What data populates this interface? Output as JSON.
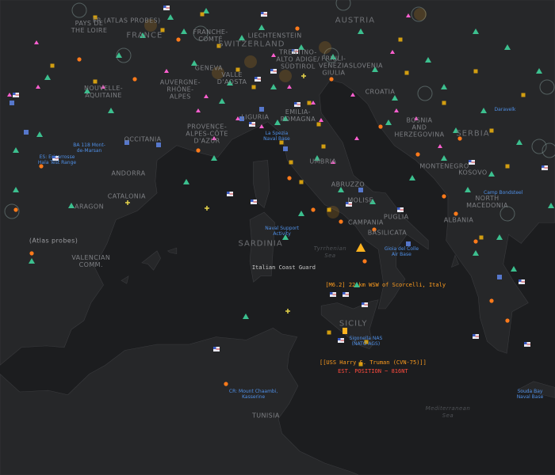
{
  "colors": {
    "land": "#262729",
    "sea": "#1c1d1f",
    "border": "#3a3b3e",
    "nuclear": "#3fd29a",
    "pink": "#ff5fd0",
    "orange": "#ff7a1a",
    "yellow": "#f1b40d",
    "base_label": "#4f8fe6",
    "alert": "#ff9d1f",
    "alert_red": "#ff4b3e"
  },
  "map_labels": [
    {
      "text": "FRANCE",
      "lon": 2.5,
      "lat": 47.2,
      "kind": "big"
    },
    {
      "text": "PAYS DE\nTHE LOIRE",
      "lon": -0.6,
      "lat": 47.5,
      "kind": "region"
    },
    {
      "text": "FR (Atlas probes)",
      "lon": 1.5,
      "lat": 47.7,
      "kind": "region"
    },
    {
      "text": "FRANCHE-\nCOMTÉ",
      "lon": 6.2,
      "lat": 47.2,
      "kind": "region"
    },
    {
      "text": "AUSTRIA",
      "lon": 14.3,
      "lat": 47.7,
      "kind": "big"
    },
    {
      "text": "LIECHTENSTEIN",
      "lon": 9.8,
      "lat": 47.2,
      "kind": "region"
    },
    {
      "text": "SWITZERLAND",
      "lon": 8.5,
      "lat": 46.9,
      "kind": "big"
    },
    {
      "text": "TRENTINO-\nALTO ADIGE/\nSÜDTIROL",
      "lon": 11.1,
      "lat": 46.4,
      "kind": "region"
    },
    {
      "text": "FRIULI-\nVENEZIA\nGIULIA",
      "lon": 13.1,
      "lat": 46.2,
      "kind": "region"
    },
    {
      "text": "SLOVENIA",
      "lon": 14.9,
      "lat": 46.2,
      "kind": "region"
    },
    {
      "text": "CROATIA",
      "lon": 15.7,
      "lat": 45.3,
      "kind": "region"
    },
    {
      "text": "NOUVELLE-\nAQUITAINE",
      "lon": 0.2,
      "lat": 45.3,
      "kind": "region"
    },
    {
      "text": "AUVERGNE-\nRHÔNE-\nALPES",
      "lon": 4.5,
      "lat": 45.4,
      "kind": "region"
    },
    {
      "text": "GENEVA",
      "lon": 6.1,
      "lat": 46.1,
      "kind": "region"
    },
    {
      "text": "VALLE\nD'AOSTA",
      "lon": 7.4,
      "lat": 45.75,
      "kind": "region"
    },
    {
      "text": "LIGURIA",
      "lon": 8.7,
      "lat": 44.45,
      "kind": "region"
    },
    {
      "text": "EMILIA-\nROMAGNA",
      "lon": 11.1,
      "lat": 44.5,
      "kind": "region"
    },
    {
      "text": "PROVENCE-\nALPES-CÔTE\nD'AZUR",
      "lon": 6.0,
      "lat": 43.9,
      "kind": "region"
    },
    {
      "text": "OCCITANIA",
      "lon": 2.4,
      "lat": 43.7,
      "kind": "region"
    },
    {
      "text": "ANDORRA",
      "lon": 1.6,
      "lat": 42.55,
      "kind": "region"
    },
    {
      "text": "CATALONIA",
      "lon": 1.5,
      "lat": 41.8,
      "kind": "region"
    },
    {
      "text": "ARAGON",
      "lon": -0.6,
      "lat": 41.45,
      "kind": "region"
    },
    {
      "text": "VALENCIAN\nCOMM.",
      "lon": -0.5,
      "lat": 39.6,
      "kind": "region"
    },
    {
      "text": "UMBRIA",
      "lon": 12.5,
      "lat": 42.95,
      "kind": "region"
    },
    {
      "text": "ABRUZZO",
      "lon": 13.9,
      "lat": 42.2,
      "kind": "region"
    },
    {
      "text": "MOLISE",
      "lon": 14.6,
      "lat": 41.65,
      "kind": "region"
    },
    {
      "text": "CAMPANIA",
      "lon": 14.9,
      "lat": 40.9,
      "kind": "region"
    },
    {
      "text": "PUGLIA",
      "lon": 16.6,
      "lat": 41.1,
      "kind": "region"
    },
    {
      "text": "BASILICATA",
      "lon": 16.1,
      "lat": 40.55,
      "kind": "region"
    },
    {
      "text": "SARDINIA",
      "lon": 9.0,
      "lat": 40.2,
      "kind": "big"
    },
    {
      "text": "SICILY",
      "lon": 14.2,
      "lat": 37.5,
      "kind": "big"
    },
    {
      "text": "BOSNIA\nAND\nHERZEGOVINA",
      "lon": 17.9,
      "lat": 44.1,
      "kind": "region"
    },
    {
      "text": "SERBIA",
      "lon": 20.9,
      "lat": 43.9,
      "kind": "big"
    },
    {
      "text": "MONTENEGRO",
      "lon": 19.3,
      "lat": 42.8,
      "kind": "region"
    },
    {
      "text": "KOSOVO",
      "lon": 20.9,
      "lat": 42.6,
      "kind": "region"
    },
    {
      "text": "NORTH\nMACEDONIA",
      "lon": 21.7,
      "lat": 41.6,
      "kind": "region"
    },
    {
      "text": "ALBANIA",
      "lon": 20.1,
      "lat": 41.0,
      "kind": "region"
    },
    {
      "text": "TUNISIA",
      "lon": 9.3,
      "lat": 34.4,
      "kind": "region"
    },
    {
      "text": "Tyrrhenian\nSea",
      "lon": 12.9,
      "lat": 39.9,
      "kind": "sea"
    },
    {
      "text": "Mediterranean\nSea",
      "lon": 19.5,
      "lat": 34.5,
      "kind": "sea"
    }
  ],
  "bases": [
    {
      "text": "ES: Ericarrosse\nHala Test Range",
      "lon": -2.4,
      "lat": 43.2
    },
    {
      "text": "BA 118 Mont-\nde-Marsan",
      "lon": -0.6,
      "lat": 43.6
    },
    {
      "text": "La Spezia\nNaval Base",
      "lon": 9.9,
      "lat": 44.0
    },
    {
      "text": "Naval Support\nActivity",
      "lon": 10.2,
      "lat": 40.8
    },
    {
      "text": "Gioia del Colle\nAir Base",
      "lon": 16.9,
      "lat": 40.1
    },
    {
      "text": "Sigonella NAS\n(NATO AGS)",
      "lon": 14.9,
      "lat": 37.1
    },
    {
      "text": "CR: Mount Chaambi,\nKasserine",
      "lon": 8.6,
      "lat": 35.3
    },
    {
      "text": "Souda Bay\nNaval Base",
      "lon": 24.1,
      "lat": 35.3
    },
    {
      "text": "Camp Bondsteel",
      "lon": 22.6,
      "lat": 42.0
    },
    {
      "text": "Daravelk",
      "lon": 22.7,
      "lat": 44.8
    }
  ],
  "alerts": [
    {
      "text": "[M6.2] 22 km WSW of Scorcelli, Italy",
      "lon": 16.0,
      "lat": 38.9,
      "color": "#ff9d1f"
    },
    {
      "text": "[[USS Harry S. Truman (CVN-75)]]",
      "lon": 15.3,
      "lat": 36.3,
      "color": "#ff9d1f"
    },
    {
      "text": "EST. POSITION ~ 816NT",
      "lon": 15.3,
      "lat": 36.0,
      "color": "#ff4b3e"
    }
  ],
  "coast_guard": {
    "text": "Italian Coast Guard",
    "lon": 10.3,
    "lat": 39.5
  },
  "atlas_probe": {
    "text": "(Atlas probes)",
    "lon": -2.6,
    "lat": 40.3
  }
}
